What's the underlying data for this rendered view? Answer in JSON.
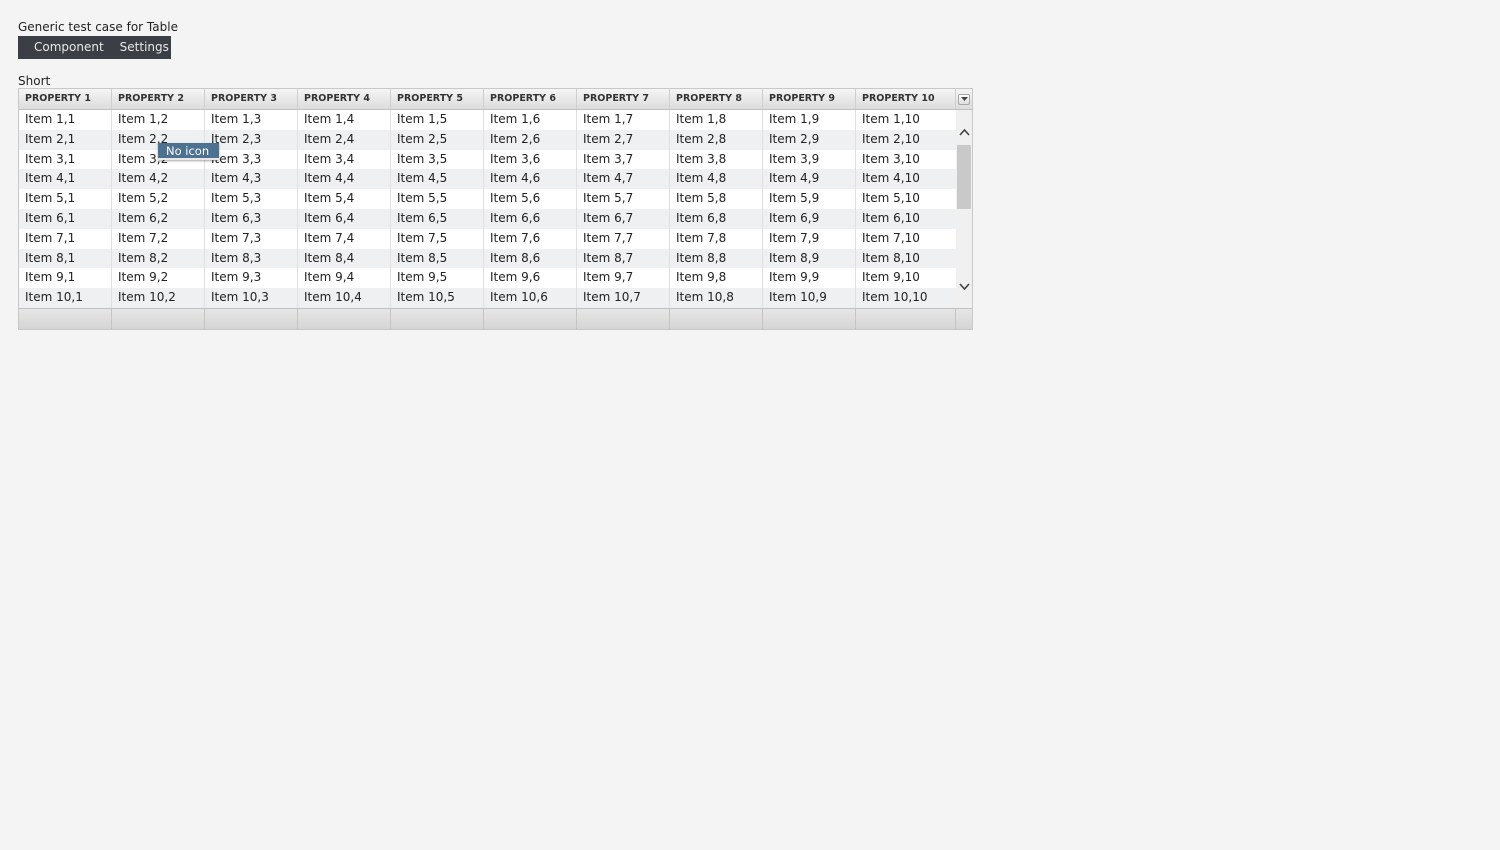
{
  "page": {
    "title": "Generic test case for Table"
  },
  "menubar": {
    "items": [
      "Component",
      "Settings"
    ]
  },
  "table": {
    "caption": "Short",
    "columns": [
      "PROPERTY 1",
      "PROPERTY 2",
      "PROPERTY 3",
      "PROPERTY 4",
      "PROPERTY 5",
      "PROPERTY 6",
      "PROPERTY 7",
      "PROPERTY 8",
      "PROPERTY 9",
      "PROPERTY 10"
    ],
    "rows": [
      [
        "Item 1,1",
        "Item 1,2",
        "Item 1,3",
        "Item 1,4",
        "Item 1,5",
        "Item 1,6",
        "Item 1,7",
        "Item 1,8",
        "Item 1,9",
        "Item 1,10"
      ],
      [
        "Item 2,1",
        "Item 2,2",
        "Item 2,3",
        "Item 2,4",
        "Item 2,5",
        "Item 2,6",
        "Item 2,7",
        "Item 2,8",
        "Item 2,9",
        "Item 2,10"
      ],
      [
        "Item 3,1",
        "Item 3,2",
        "Item 3,3",
        "Item 3,4",
        "Item 3,5",
        "Item 3,6",
        "Item 3,7",
        "Item 3,8",
        "Item 3,9",
        "Item 3,10"
      ],
      [
        "Item 4,1",
        "Item 4,2",
        "Item 4,3",
        "Item 4,4",
        "Item 4,5",
        "Item 4,6",
        "Item 4,7",
        "Item 4,8",
        "Item 4,9",
        "Item 4,10"
      ],
      [
        "Item 5,1",
        "Item 5,2",
        "Item 5,3",
        "Item 5,4",
        "Item 5,5",
        "Item 5,6",
        "Item 5,7",
        "Item 5,8",
        "Item 5,9",
        "Item 5,10"
      ],
      [
        "Item 6,1",
        "Item 6,2",
        "Item 6,3",
        "Item 6,4",
        "Item 6,5",
        "Item 6,6",
        "Item 6,7",
        "Item 6,8",
        "Item 6,9",
        "Item 6,10"
      ],
      [
        "Item 7,1",
        "Item 7,2",
        "Item 7,3",
        "Item 7,4",
        "Item 7,5",
        "Item 7,6",
        "Item 7,7",
        "Item 7,8",
        "Item 7,9",
        "Item 7,10"
      ],
      [
        "Item 8,1",
        "Item 8,2",
        "Item 8,3",
        "Item 8,4",
        "Item 8,5",
        "Item 8,6",
        "Item 8,7",
        "Item 8,8",
        "Item 8,9",
        "Item 8,10"
      ],
      [
        "Item 9,1",
        "Item 9,2",
        "Item 9,3",
        "Item 9,4",
        "Item 9,5",
        "Item 9,6",
        "Item 9,7",
        "Item 9,8",
        "Item 9,9",
        "Item 9,10"
      ],
      [
        "Item 10,1",
        "Item 10,2",
        "Item 10,3",
        "Item 10,4",
        "Item 10,5",
        "Item 10,6",
        "Item 10,7",
        "Item 10,8",
        "Item 10,9",
        "Item 10,10"
      ]
    ],
    "column_menu_icon": "chevron-down-icon",
    "scroll_up_icon": "chevron-up-icon",
    "scroll_down_icon": "chevron-down-icon"
  },
  "tooltip": {
    "text": "No icon"
  },
  "colors": {
    "menubar_bg": "#3b3e44",
    "tooltip_bg": "#4d7190",
    "row_alt": "#eff0f1"
  }
}
